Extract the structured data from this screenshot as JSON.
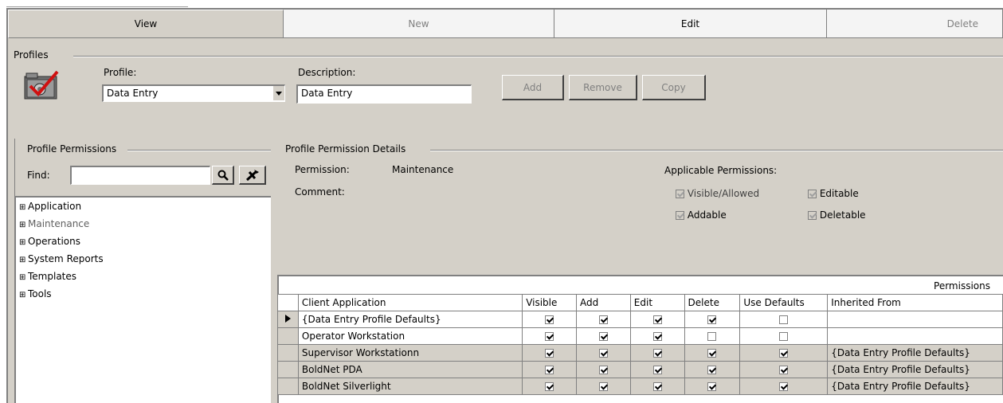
{
  "actions": {
    "view": "View",
    "new": "New",
    "edit": "Edit",
    "delete": "Delete"
  },
  "profiles_group": {
    "title": "Profiles",
    "profile_label": "Profile:",
    "profile_value": "Data Entry",
    "description_label": "Description:",
    "description_value": "Data Entry",
    "add_label": "Add",
    "remove_label": "Remove",
    "copy_label": "Copy",
    "icon": "profile-folder-check-icon"
  },
  "permissions_group": {
    "title": "Profile Permissions",
    "find_label": "Find:",
    "find_value": "",
    "tree": [
      {
        "label": "Application"
      },
      {
        "label": "Maintenance"
      },
      {
        "label": "Operations"
      },
      {
        "label": "System Reports"
      },
      {
        "label": "Templates"
      },
      {
        "label": "Tools"
      }
    ]
  },
  "details_group": {
    "title": "Profile Permission Details",
    "permission_label": "Permission:",
    "permission_value": "Maintenance",
    "comment_label": "Comment:",
    "applicable_label": "Applicable Permissions:",
    "visible_allowed": "Visible/Allowed",
    "editable": "Editable",
    "addable": "Addable",
    "deletable": "Deletable"
  },
  "grid": {
    "caption": "Permissions",
    "columns": [
      "Client Application",
      "Visible",
      "Add",
      "Edit",
      "Delete",
      "Use Defaults",
      "Inherited From"
    ],
    "rows": [
      {
        "app": "{Data Entry Profile Defaults}",
        "visible": true,
        "add": true,
        "edit": true,
        "delete": true,
        "use_defaults": false,
        "inherited": "",
        "current": true
      },
      {
        "app": "Operator Workstation",
        "visible": true,
        "add": true,
        "edit": true,
        "delete": false,
        "use_defaults": false,
        "inherited": "",
        "current": false
      },
      {
        "app": "Supervisor Workstationn",
        "visible": true,
        "add": true,
        "edit": true,
        "delete": true,
        "use_defaults": true,
        "inherited": "{Data Entry Profile Defaults}",
        "current": false
      },
      {
        "app": "BoldNet PDA",
        "visible": true,
        "add": true,
        "edit": true,
        "delete": true,
        "use_defaults": true,
        "inherited": "{Data Entry Profile Defaults}",
        "current": false
      },
      {
        "app": "BoldNet Silverlight",
        "visible": true,
        "add": true,
        "edit": true,
        "delete": true,
        "use_defaults": true,
        "inherited": "{Data Entry Profile Defaults}",
        "current": false
      }
    ]
  }
}
